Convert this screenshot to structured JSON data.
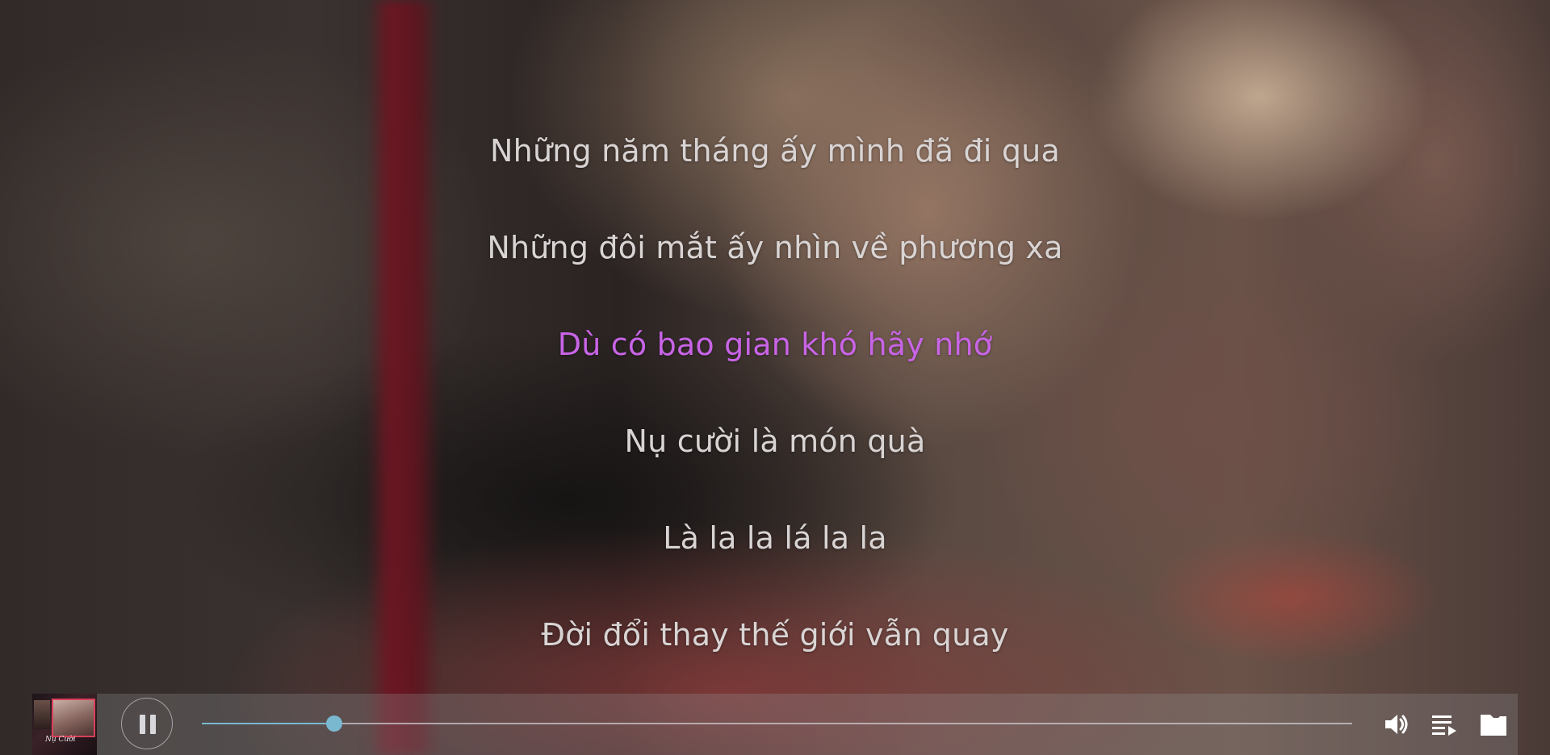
{
  "lyrics": {
    "lines": [
      "Những năm tháng ấy mình đã đi qua",
      "Những đôi mắt ấy nhìn về phương xa",
      "Dù có bao gian khó hãy nhớ",
      "Nụ cười là món quà",
      "Là la la lá la la",
      "Đời đổi thay thế giới vẫn quay"
    ],
    "active_index": 2,
    "active_color": "#c864e6"
  },
  "player": {
    "state": "playing",
    "pause_icon": "pause-icon",
    "progress_fraction": 0.115,
    "accent_color": "#7ab8d0",
    "album_art_text": "Nụ Cười",
    "icons": {
      "volume": "volume-icon",
      "queue": "queue-icon",
      "folder": "folder-icon"
    }
  }
}
